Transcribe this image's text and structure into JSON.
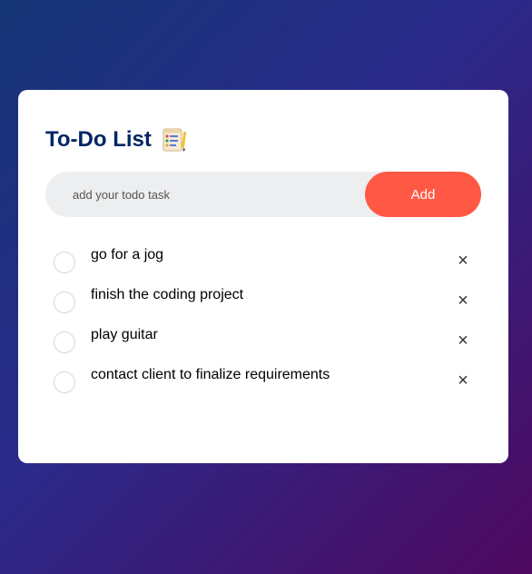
{
  "header": {
    "title": "To-Do List",
    "icon": "checklist-with-pencil-icon"
  },
  "input": {
    "placeholder": "add your todo task",
    "value": ""
  },
  "add_button": {
    "label": "Add"
  },
  "tasks": [
    {
      "text": "go for a jog",
      "checked": false
    },
    {
      "text": "finish the coding project",
      "checked": false
    },
    {
      "text": "play guitar",
      "checked": false
    },
    {
      "text": "contact client to finalize requirements",
      "checked": false
    }
  ],
  "delete_symbol": "×",
  "colors": {
    "accent": "#ff5945",
    "title": "#002765",
    "input_bg": "#edeef0",
    "background_start": "#153677",
    "background_end": "#4e085f"
  }
}
